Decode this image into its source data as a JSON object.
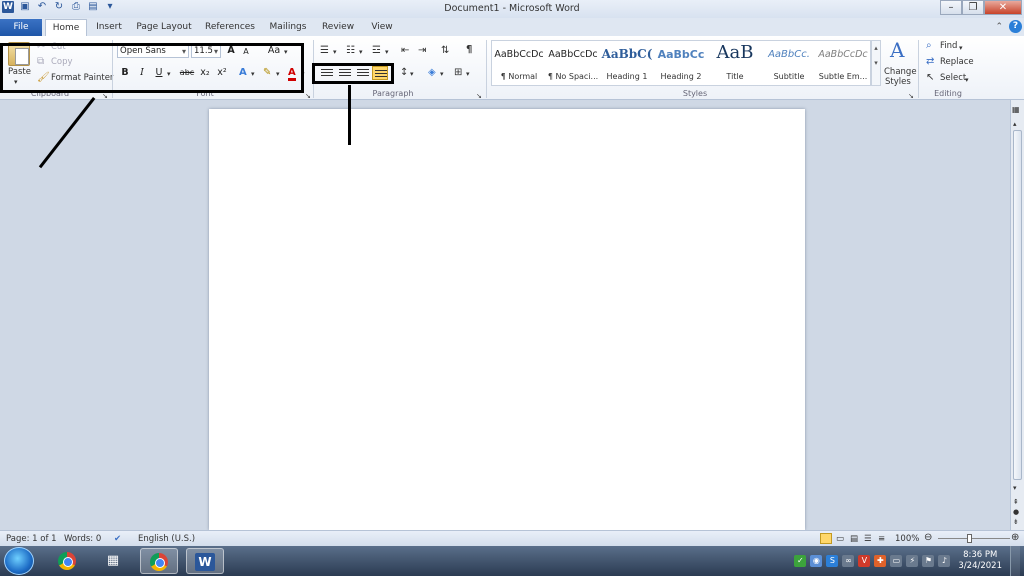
{
  "window": {
    "title": "Document1 - Microsoft Word",
    "minimize_glyph": "–",
    "maximize_glyph": "❐",
    "close_glyph": "✕"
  },
  "qat": {
    "save_icon": "save-icon",
    "undo_icon": "undo-icon",
    "redo_icon": "redo-icon"
  },
  "tabs": [
    {
      "label": "File"
    },
    {
      "label": "Home"
    },
    {
      "label": "Insert"
    },
    {
      "label": "Page Layout"
    },
    {
      "label": "References"
    },
    {
      "label": "Mailings"
    },
    {
      "label": "Review"
    },
    {
      "label": "View"
    }
  ],
  "clipboard": {
    "paste_label": "Paste",
    "cut_label": "Cut",
    "copy_label": "Copy",
    "format_painter_label": "Format Painter",
    "group_label": "Clipboard"
  },
  "font": {
    "font_name": "Open Sans",
    "font_size": "11.5",
    "grow": "A",
    "shrink": "A",
    "change_case": "Aa",
    "bold": "B",
    "italic": "I",
    "underline": "U",
    "strike": "abc",
    "subscript": "x₂",
    "superscript": "x²",
    "group_label": "Font"
  },
  "paragraph": {
    "group_label": "Paragraph",
    "pilcrow": "¶"
  },
  "styles": {
    "group_label": "Styles",
    "items": [
      {
        "sample": "AaBbCcDc",
        "name": "¶ Normal"
      },
      {
        "sample": "AaBbCcDc",
        "name": "¶ No Spaci..."
      },
      {
        "sample": "AaBbC(",
        "name": "Heading 1"
      },
      {
        "sample": "AaBbCc",
        "name": "Heading 2"
      },
      {
        "sample": "AaB",
        "name": "Title"
      },
      {
        "sample": "AaBbCc.",
        "name": "Subtitle"
      },
      {
        "sample": "AaBbCcDc",
        "name": "Subtle Em..."
      }
    ],
    "change_styles_1": "Change",
    "change_styles_2": "Styles"
  },
  "editing": {
    "find_label": "Find",
    "replace_label": "Replace",
    "select_label": "Select",
    "group_label": "Editing"
  },
  "statusbar": {
    "page": "Page: 1 of 1",
    "words": "Words: 0",
    "language": "English (U.S.)",
    "zoom": "100%"
  },
  "taskbar": {
    "time": "8:36 PM",
    "date": "3/24/2021"
  },
  "colors": {
    "accent": "#2b579a",
    "file_tab": "#1f56a8",
    "selected_button": "#ffd76a"
  }
}
